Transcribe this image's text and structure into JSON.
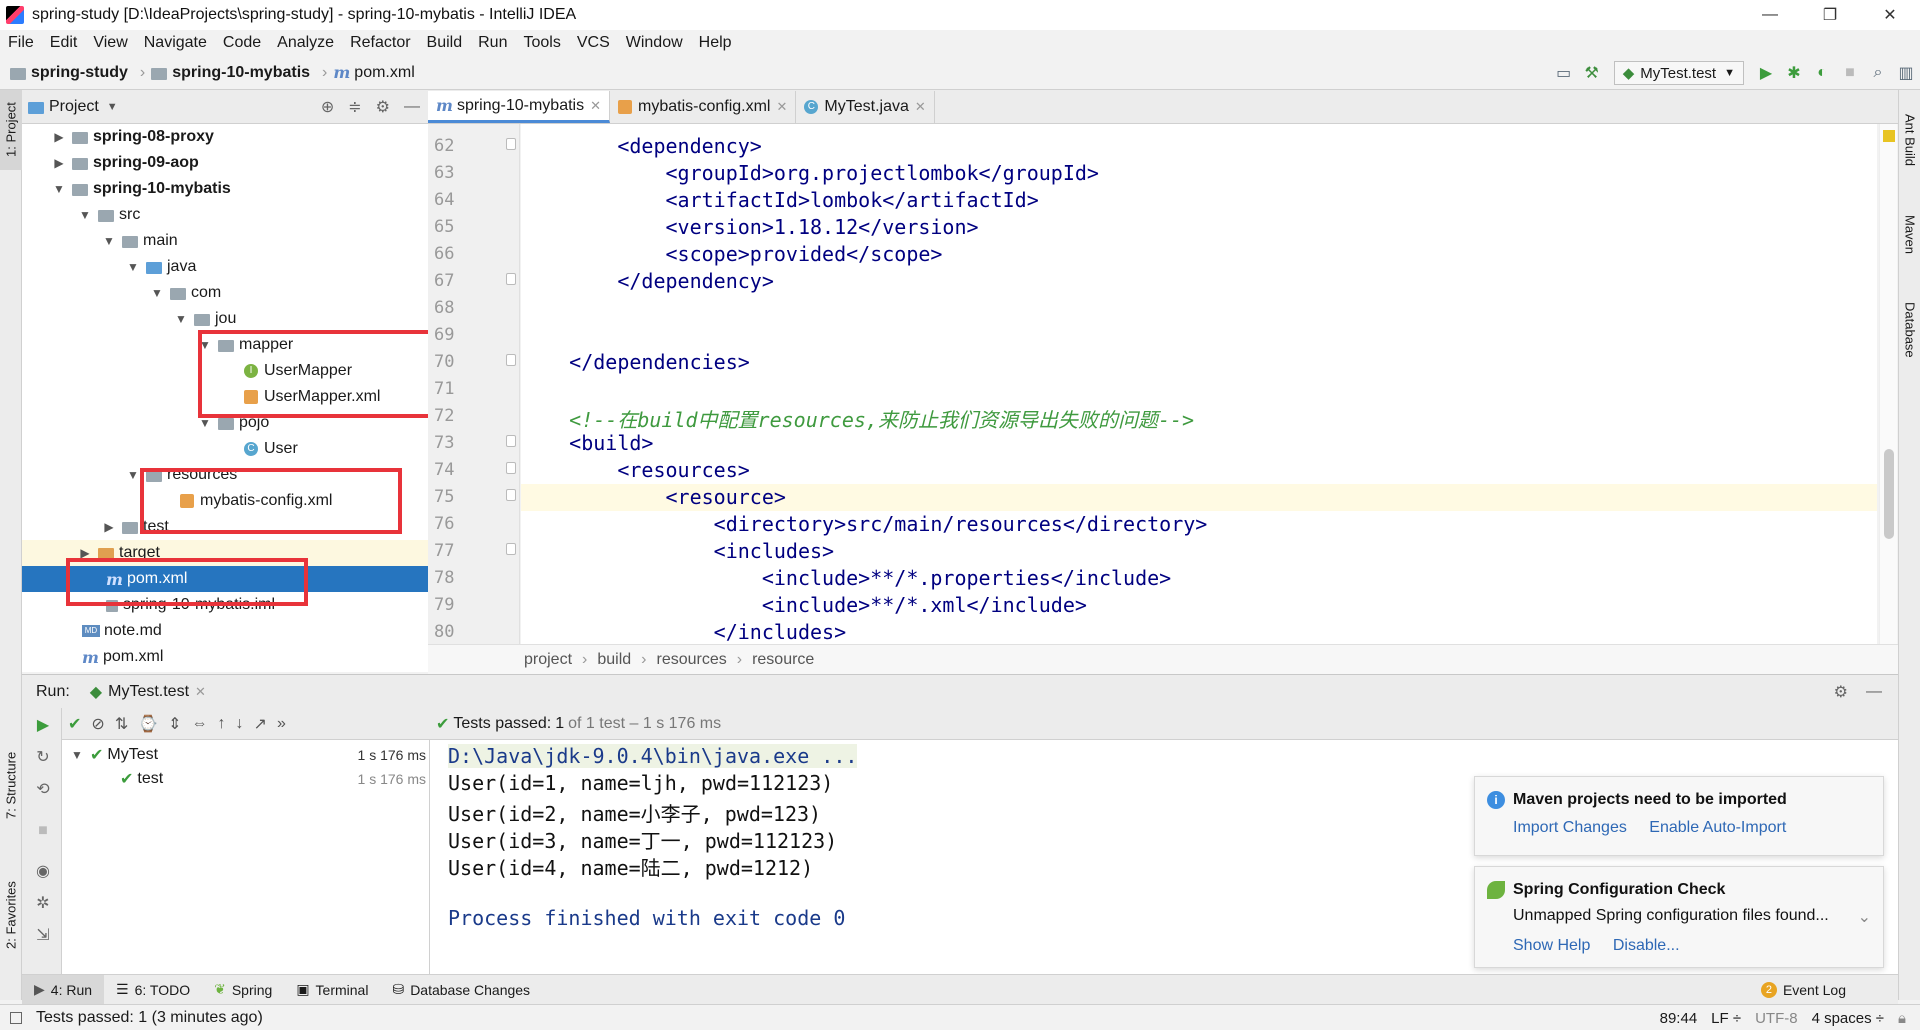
{
  "window": {
    "title": "spring-study [D:\\IdeaProjects\\spring-study] - spring-10-mybatis - IntelliJ IDEA",
    "minimize": "—",
    "restore": "❐",
    "close": "✕"
  },
  "menu": [
    "File",
    "Edit",
    "View",
    "Navigate",
    "Code",
    "Analyze",
    "Refactor",
    "Build",
    "Run",
    "Tools",
    "VCS",
    "Window",
    "Help"
  ],
  "nav": {
    "crumbs": [
      "spring-study",
      "spring-10-mybatis",
      "pom.xml"
    ],
    "run_config": "MyTest.test"
  },
  "left_strip": {
    "project": "1: Project",
    "structure": "7: Structure",
    "favorites": "2: Favorites"
  },
  "right_strip": {
    "ant": "Ant Build",
    "maven": "Maven",
    "database": "Database"
  },
  "project_panel": {
    "title": "Project",
    "tree": [
      {
        "label": "spring-08-proxy",
        "bold": true
      },
      {
        "label": "spring-09-aop",
        "bold": true
      },
      {
        "label": "spring-10-mybatis",
        "bold": true
      },
      {
        "label": "src"
      },
      {
        "label": "main"
      },
      {
        "label": "java"
      },
      {
        "label": "com"
      },
      {
        "label": "jou"
      },
      {
        "label": "mapper"
      },
      {
        "label": "UserMapper"
      },
      {
        "label": "UserMapper.xml"
      },
      {
        "label": "pojo"
      },
      {
        "label": "User"
      },
      {
        "label": "resources"
      },
      {
        "label": "mybatis-config.xml"
      },
      {
        "label": "test"
      },
      {
        "label": "target"
      },
      {
        "label": "pom.xml",
        "selected": true
      },
      {
        "label": "spring-10-mybatis.iml"
      },
      {
        "label": "note.md"
      },
      {
        "label": "pom.xml"
      }
    ]
  },
  "editor": {
    "tabs": [
      {
        "label": "spring-10-mybatis",
        "active": true
      },
      {
        "label": "mybatis-config.xml"
      },
      {
        "label": "MyTest.java"
      }
    ],
    "line_numbers": [
      "62",
      "63",
      "64",
      "65",
      "66",
      "67",
      "68",
      "69",
      "70",
      "71",
      "72",
      "73",
      "74",
      "75",
      "76",
      "77",
      "78",
      "79",
      "80"
    ],
    "lines": [
      "        <dependency>",
      "            <groupId>org.projectlombok</groupId>",
      "            <artifactId>lombok</artifactId>",
      "            <version>1.18.12</version>",
      "            <scope>provided</scope>",
      "        </dependency>",
      "",
      "",
      "    </dependencies>",
      "",
      "    <!--在build中配置resources,来防止我们资源导出失败的问题-->",
      "    <build>",
      "        <resources>",
      "            <resource>",
      "                <directory>src/main/resources</directory>",
      "                <includes>",
      "                    <include>**/*.properties</include>",
      "                    <include>**/*.xml</include>",
      "                </includes>"
    ],
    "breadcrumb": [
      "project",
      "build",
      "resources",
      "resource"
    ]
  },
  "run_panel": {
    "label": "Run:",
    "tab": "MyTest.test",
    "status_prefix": "Tests passed:",
    "status_count": "1",
    "status_suffix": "of 1 test – 1 s 176 ms",
    "tests": [
      {
        "name": "MyTest",
        "time": "1 s 176 ms"
      },
      {
        "name": "test",
        "time": "1 s 176 ms"
      }
    ],
    "console": [
      "D:\\Java\\jdk-9.0.4\\bin\\java.exe ...",
      "User(id=1, name=ljh, pwd=112123)",
      "User(id=2, name=小李子, pwd=123)",
      "User(id=3, name=丁一, pwd=112123)",
      "User(id=4, name=陆二, pwd=1212)",
      "",
      "Process finished with exit code 0"
    ]
  },
  "notifications": [
    {
      "title": "Maven projects need to be imported",
      "links": [
        "Import Changes",
        "Enable Auto-Import"
      ]
    },
    {
      "title": "Spring Configuration Check",
      "body": "Unmapped Spring configuration files found...",
      "links": [
        "Show Help",
        "Disable..."
      ]
    }
  ],
  "bottom_tabs": [
    "4: Run",
    "6: TODO",
    "Spring",
    "Terminal",
    "Database Changes"
  ],
  "event_log": {
    "count": "2",
    "label": "Event Log"
  },
  "status_bar": {
    "message": "Tests passed: 1 (3 minutes ago)",
    "position": "89:44",
    "line_sep": "LF ÷",
    "encoding": "UTF-8",
    "indent": "4 spaces ÷"
  }
}
